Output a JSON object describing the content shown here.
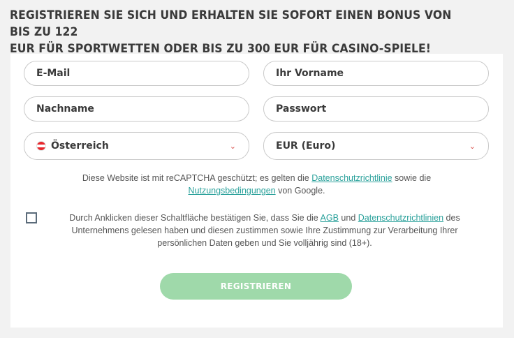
{
  "headline": {
    "line1": "REGISTRIEREN SIE SICH UND ERHALTEN SIE SOFORT EINEN BONUS VON BIS ZU 122",
    "line2": "EUR FÜR SPORTWETTEN ODER BIS ZU 300 EUR FÜR CASINO-SPIELE!"
  },
  "form": {
    "email_placeholder": "E-Mail",
    "firstname_placeholder": "Ihr Vorname",
    "lastname_placeholder": "Nachname",
    "password_placeholder": "Passwort",
    "country_value": "Österreich",
    "country_flag_icon": "austria-flag-icon",
    "currency_value": "EUR (Euro)",
    "chevron_icon": "chevron-down-icon",
    "chevron_glyph": "⌄"
  },
  "recaptcha": {
    "prefix": "Diese Website ist mit reCAPTCHA geschützt; es gelten die ",
    "privacy_link": "Datenschutzrichtlinie",
    "middle": " sowie die",
    "terms_link": "Nutzungsbedingungen",
    "suffix": " von Google."
  },
  "consent": {
    "prefix": "Durch Anklicken dieser Schaltfläche bestätigen Sie, dass Sie die ",
    "agb_link": "AGB",
    "and": " und ",
    "privacy_link": "Datenschutzrichtlinien",
    "suffix": " des Unternehmens gelesen haben und diesen zustimmen sowie Ihre Zustimmung zur Verarbeitung Ihrer persönlichen Daten geben und Sie volljährig sind (18+)."
  },
  "submit_label": "REGISTRIEREN",
  "colors": {
    "link": "#2aa19b",
    "button": "#9fd9aa",
    "chevron": "#d9534f"
  }
}
